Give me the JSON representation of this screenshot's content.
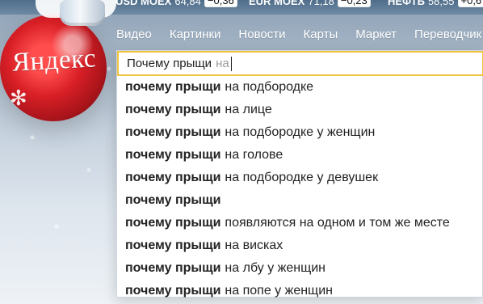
{
  "ticker": [
    {
      "name": "USD MOEX",
      "value": "64,84",
      "change": "−0,36"
    },
    {
      "name": "EUR MOEX",
      "value": "71,18",
      "change": "−0,23"
    },
    {
      "name": "НЕФТЬ",
      "value": "58,55",
      "change": "+0,6"
    }
  ],
  "logo": {
    "text": "Яндекс"
  },
  "nav": {
    "items": [
      "Видео",
      "Картинки",
      "Новости",
      "Карты",
      "Маркет",
      "Переводчик"
    ]
  },
  "search": {
    "typed": "Почему прыщи",
    "autocomplete_tail": "на"
  },
  "suggestions": [
    {
      "bold": "почему прыщи",
      "rest": "на подбородке"
    },
    {
      "bold": "почему прыщи",
      "rest": "на лице"
    },
    {
      "bold": "почему прыщи",
      "rest": "на подбородке у женщин"
    },
    {
      "bold": "почему прыщи",
      "rest": "на голове"
    },
    {
      "bold": "почему прыщи",
      "rest": "на подбородке у девушек"
    },
    {
      "bold": "почему прыщи",
      "rest": ""
    },
    {
      "bold": "почему прыщи",
      "rest": "появляются на одном и том же месте"
    },
    {
      "bold": "почему прыщи",
      "rest": "на висках"
    },
    {
      "bold": "почему прыщи",
      "rest": "на лбу у женщин"
    },
    {
      "bold": "почему прыщи",
      "rest": "на попе у женщин"
    }
  ]
}
